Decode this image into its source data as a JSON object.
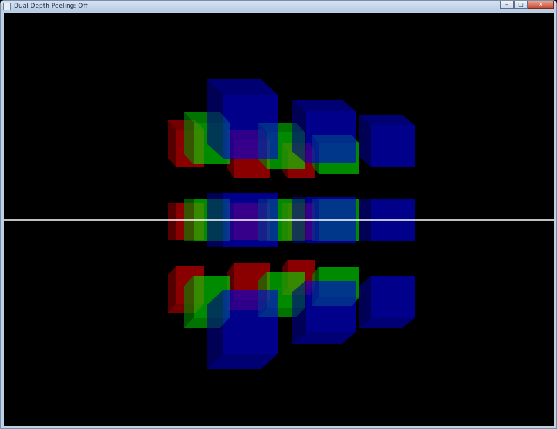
{
  "window": {
    "title": "Dual Depth Peeling: Off",
    "minimize_glyph": "–",
    "maximize_glyph": "□",
    "close_glyph": "✕",
    "icon": "app-window-icon"
  },
  "scene": {
    "background": "#000000",
    "colors": {
      "red": "#ff0000",
      "green": "#00ff00",
      "blue": "#0000ff",
      "horizon_line": "#ffffff"
    },
    "cube_opacity": 0.6,
    "layers": [
      "upper",
      "middle",
      "lower"
    ]
  }
}
